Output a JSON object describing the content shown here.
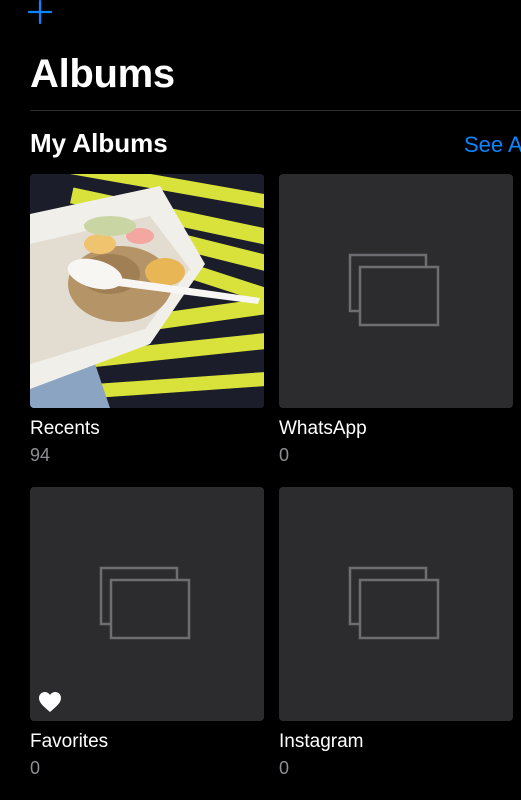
{
  "header": {
    "add_icon": "plus-icon",
    "title": "Albums"
  },
  "my_albums": {
    "section_title": "My Albums",
    "see_all": "See A",
    "items": [
      {
        "name": "Recents",
        "count": "94",
        "thumbnail": "photo"
      },
      {
        "name": "WhatsApp",
        "count": "0",
        "thumbnail": "placeholder-stack-icon"
      },
      {
        "name": "Favorites",
        "count": "0",
        "thumbnail": "placeholder-stack-icon",
        "badge_icon": "heart-icon"
      },
      {
        "name": "Instagram",
        "count": "0",
        "thumbnail": "placeholder-stack-icon"
      }
    ]
  },
  "colors": {
    "background": "#000000",
    "accent": "#0a84ff",
    "tile": "#2c2c2e",
    "secondary_text": "#8e8e93",
    "placeholder_stroke": "#6d6d72"
  }
}
